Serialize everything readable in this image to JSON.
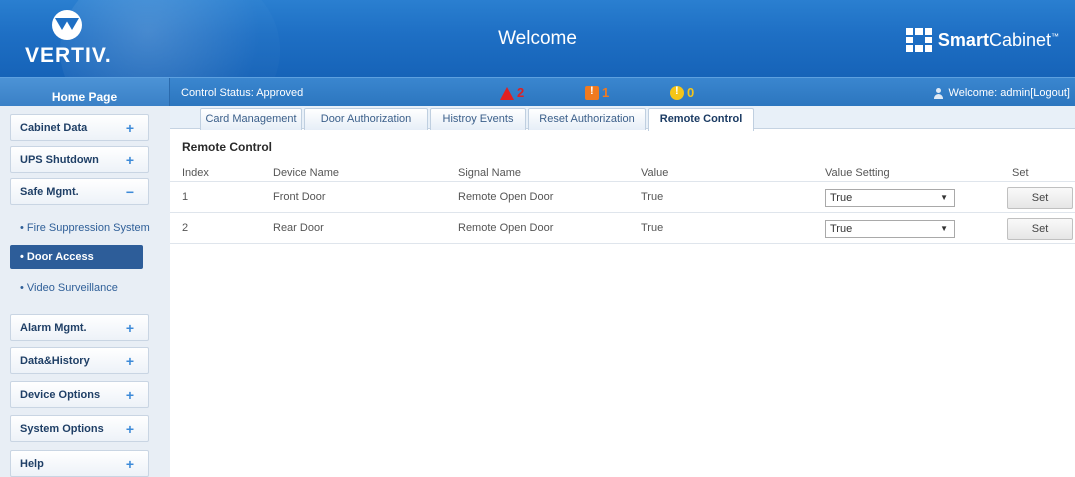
{
  "header": {
    "brand": "VERTIV.",
    "title": "Welcome",
    "product_bold": "Smart",
    "product_rest": "Cabinet",
    "trademark": "™"
  },
  "statusbar": {
    "home": "Home Page",
    "control_status": "Control Status:  Approved",
    "alarms": [
      {
        "icon": "critical-alarm-icon",
        "count": "2",
        "color": "#e02020"
      },
      {
        "icon": "major-alarm-icon",
        "count": "1",
        "color": "#f07a20"
      },
      {
        "icon": "minor-alarm-icon",
        "count": "0",
        "color": "#f5c518"
      }
    ],
    "welcome_user": "Welcome: admin[Logout]"
  },
  "sidebar": {
    "items": [
      {
        "label": "Cabinet Data",
        "sign": "+"
      },
      {
        "label": "UPS Shutdown",
        "sign": "+"
      },
      {
        "label": "Safe Mgmt.",
        "sign": "−"
      },
      {
        "label": "Alarm Mgmt.",
        "sign": "+"
      },
      {
        "label": "Data&History",
        "sign": "+"
      },
      {
        "label": "Device Options",
        "sign": "+"
      },
      {
        "label": "System Options",
        "sign": "+"
      },
      {
        "label": "Help",
        "sign": "+"
      }
    ],
    "sub_items": [
      {
        "label": "• Fire Suppression System"
      },
      {
        "label": "• Door Access"
      },
      {
        "label": "• Video Surveillance"
      }
    ]
  },
  "tabs": [
    {
      "label": "Card Management"
    },
    {
      "label": "Door Authorization"
    },
    {
      "label": "Histroy Events"
    },
    {
      "label": "Reset Authorization"
    },
    {
      "label": "Remote Control"
    }
  ],
  "section_title": "Remote Control",
  "table": {
    "headers": [
      "Index",
      "Device Name",
      "Signal Name",
      "Value",
      "Value Setting",
      "Set"
    ],
    "rows": [
      {
        "index": "1",
        "device": "Front Door",
        "signal": "Remote Open Door",
        "value": "True",
        "setting": "True",
        "button": "Set"
      },
      {
        "index": "2",
        "device": "Rear Door",
        "signal": "Remote Open Door",
        "value": "True",
        "setting": "True",
        "button": "Set"
      }
    ]
  }
}
